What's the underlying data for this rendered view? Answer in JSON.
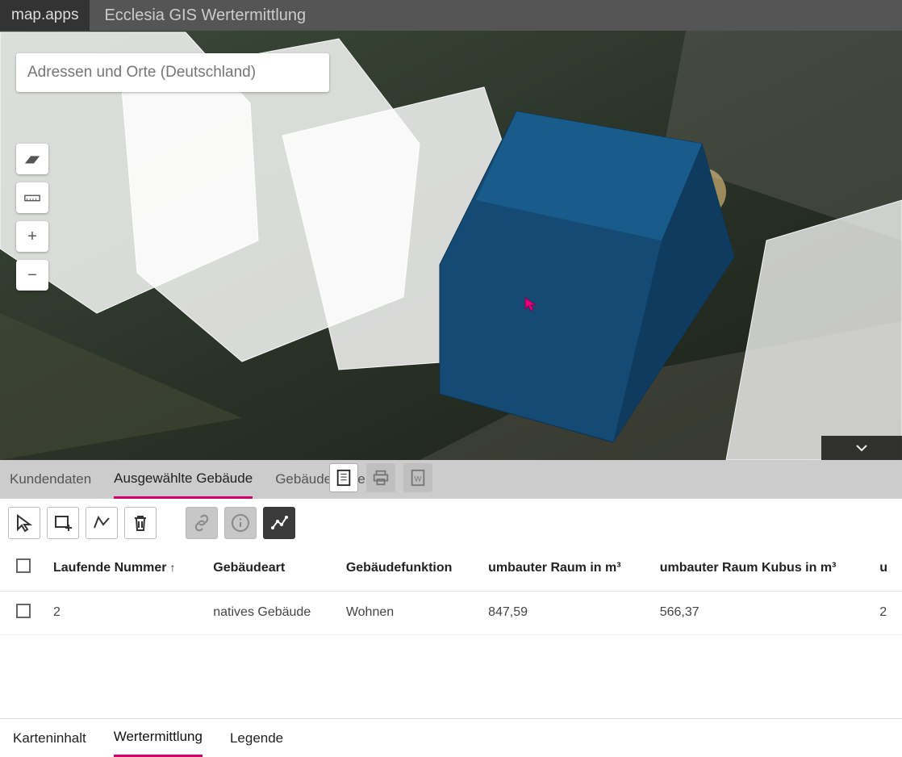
{
  "header": {
    "logo": "map.apps",
    "title": "Ecclesia GIS Wertermittlung"
  },
  "search": {
    "placeholder": "Adressen und Orte (Deutschland)"
  },
  "mapControls": {
    "zoomIn": "+",
    "zoomOut": "−"
  },
  "midTabs": {
    "items": [
      "Kundendaten",
      "Ausgewählte Gebäude",
      "Gebäudewerte"
    ],
    "activeIndex": 1
  },
  "table": {
    "columns": [
      "",
      "Laufende Nummer",
      "Gebäudeart",
      "Gebäudefunktion",
      "umbauter Raum in m³",
      "umbauter Raum Kubus in m³",
      "u"
    ],
    "sortedColumn": 1,
    "rows": [
      {
        "nummer": "2",
        "art": "natives Gebäude",
        "funktion": "Wohnen",
        "raum": "847,59",
        "kubus": "566,37",
        "last": "2"
      }
    ]
  },
  "bottomTabs": {
    "items": [
      "Karteninhalt",
      "Wertermittlung",
      "Legende"
    ],
    "activeIndex": 1
  }
}
